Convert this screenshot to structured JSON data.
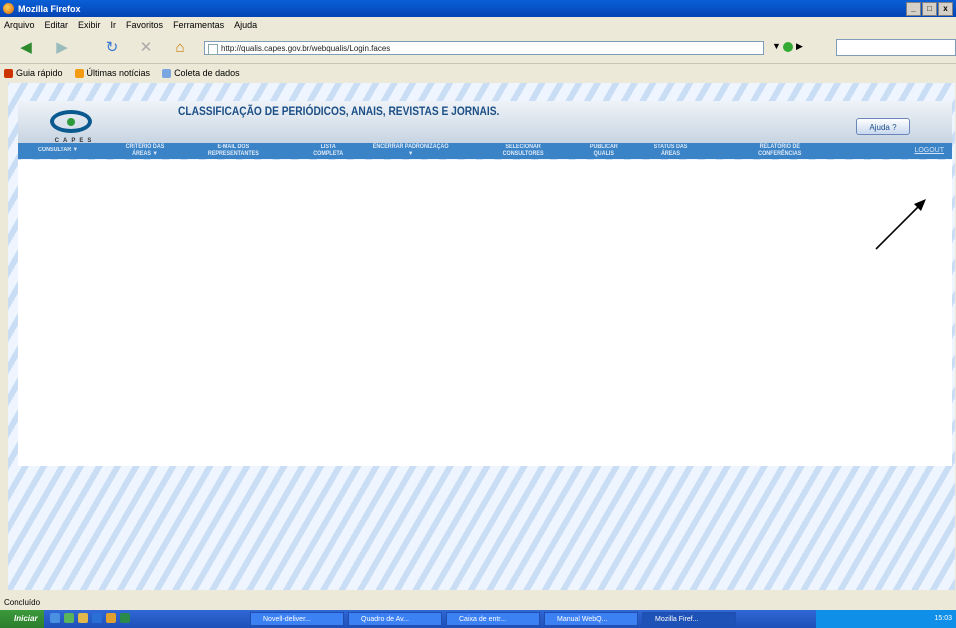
{
  "window": {
    "title": "Mozilla Firefox",
    "controls": [
      "_",
      "□",
      "x"
    ]
  },
  "menubar": [
    "Arquivo",
    "Editar",
    "Exibir",
    "Ir",
    "Favoritos",
    "Ferramentas",
    "Ajuda"
  ],
  "navbar": {
    "url": "http://qualis.capes.gov.br/webqualis/Login.faces",
    "go_label": "▶"
  },
  "bookmarks": [
    {
      "label": "Guia rápido",
      "color": "#cc3300"
    },
    {
      "label": "Últimas notícias",
      "color": "#f39c12"
    },
    {
      "label": "Coleta de dados",
      "color": "#7aa7e0"
    }
  ],
  "page": {
    "logo_text": "CAPES",
    "title": "CLASSIFICAÇÃO DE PERIÓDICOS, ANAIS, REVISTAS E JORNAIS.",
    "help_button": "Ajuda ?",
    "menu": [
      {
        "label": "CONSULTAR ▼"
      },
      {
        "label": "CRITÉRIO DAS ÁREAS ▼"
      },
      {
        "label": "E-MAIL DOS REPRESENTANTES"
      },
      {
        "label": "LISTA COMPLETA"
      },
      {
        "label": "ENCERRAR PADRONIZAÇÃO ▼"
      },
      {
        "label": "SELECIONAR CONSULTORES"
      },
      {
        "label": "PUBLICAR QUALIS"
      },
      {
        "label": "STATUS DAS ÁREAS"
      },
      {
        "label": "RELATÓRIO DE CONFERÊNCIAS"
      }
    ],
    "logout": "LOGOUT"
  },
  "status": "Concluído",
  "taskbar": {
    "start": "Iniciar",
    "tasks": [
      "Novell-deliver...",
      "Quadro de Av...",
      "Caixa de entr...",
      "Manual WebQ...",
      "Mozilla Firef..."
    ],
    "clock": "15:03"
  }
}
